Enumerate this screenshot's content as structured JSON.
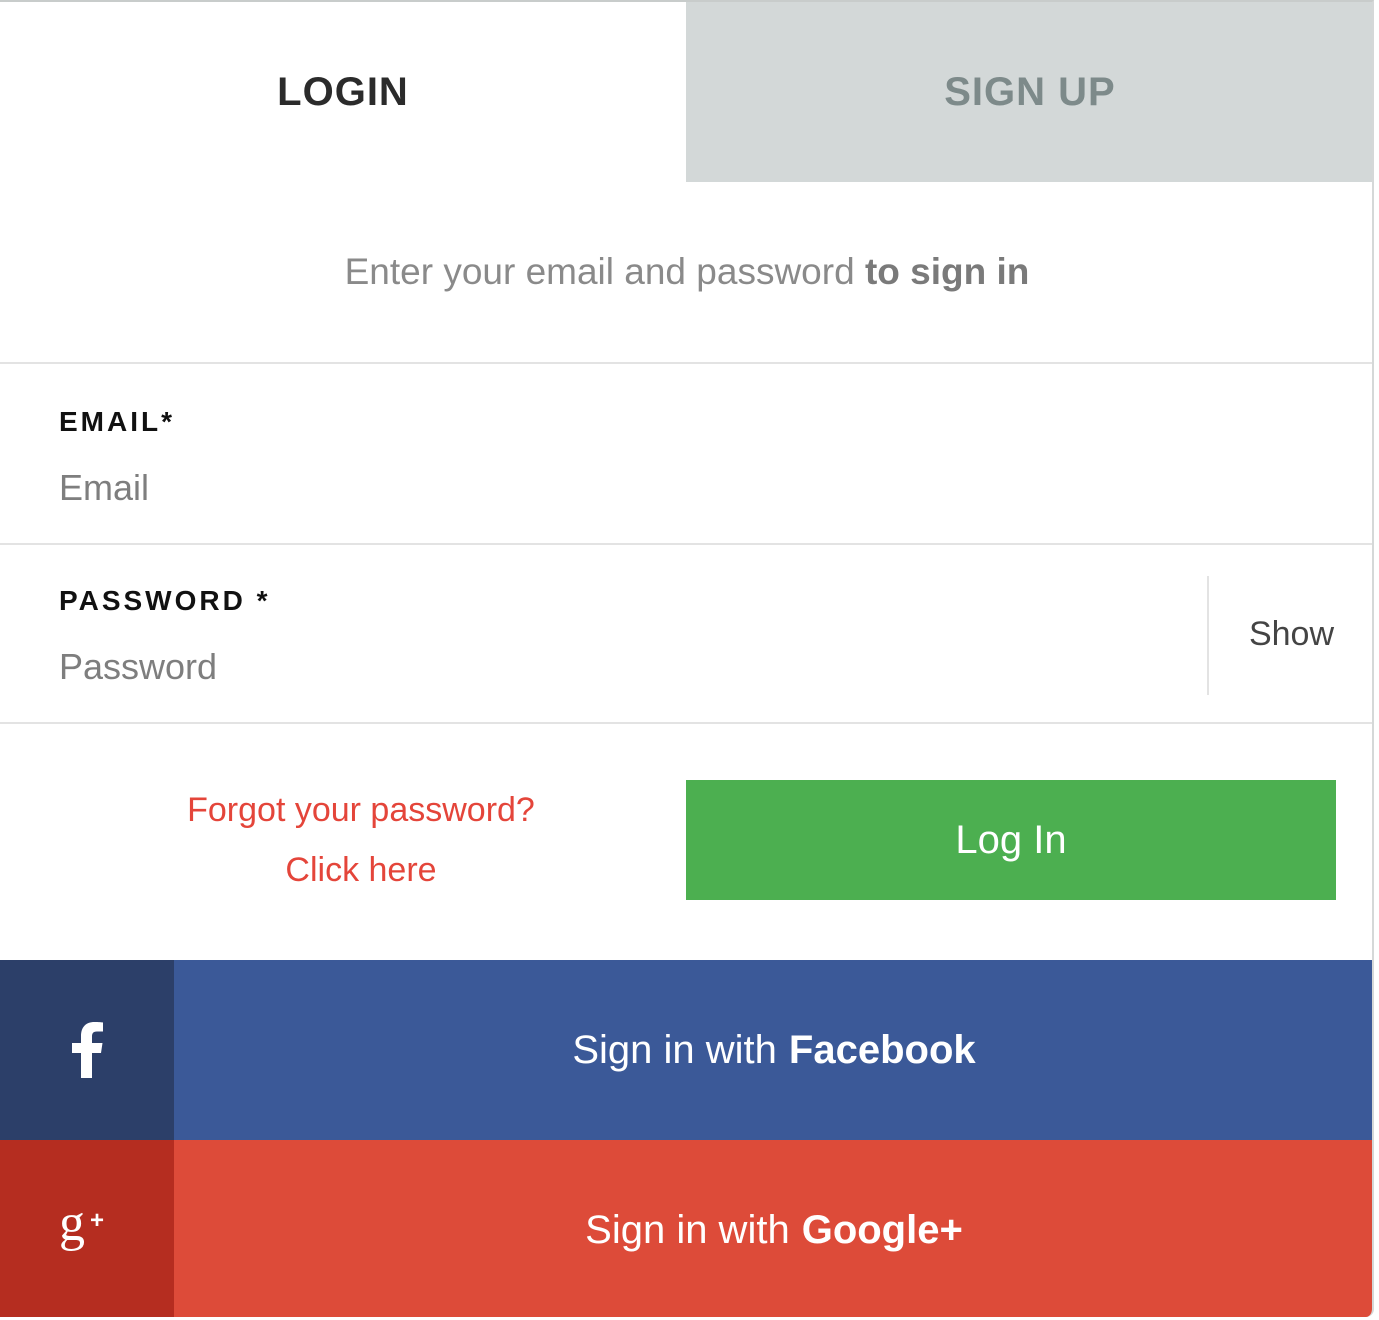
{
  "tabs": {
    "login": "LOGIN",
    "signup": "SIGN UP"
  },
  "subtitle": {
    "normal": "Enter your email and password",
    "bold": "to sign in"
  },
  "email": {
    "label": "EMAIL*",
    "placeholder": "Email",
    "value": ""
  },
  "password": {
    "label": "PASSWORD *",
    "placeholder": "Password",
    "value": "",
    "show_label": "Show"
  },
  "forgot": {
    "line1": "Forgot your password?",
    "line2": "Click here"
  },
  "login_button": "Log In",
  "social": {
    "facebook": {
      "prefix": "Sign in with",
      "provider": "Facebook",
      "icon": "facebook-icon"
    },
    "google": {
      "prefix": "Sign in with",
      "provider": "Google+",
      "icon": "google-plus-icon"
    }
  },
  "colors": {
    "login_button": "#4caf50",
    "link": "#e4453a",
    "facebook": "#3b5998",
    "facebook_dark": "#2c3f69",
    "google": "#dd4b39",
    "google_dark": "#b52d20",
    "inactive_tab": "#d3d8d8"
  }
}
